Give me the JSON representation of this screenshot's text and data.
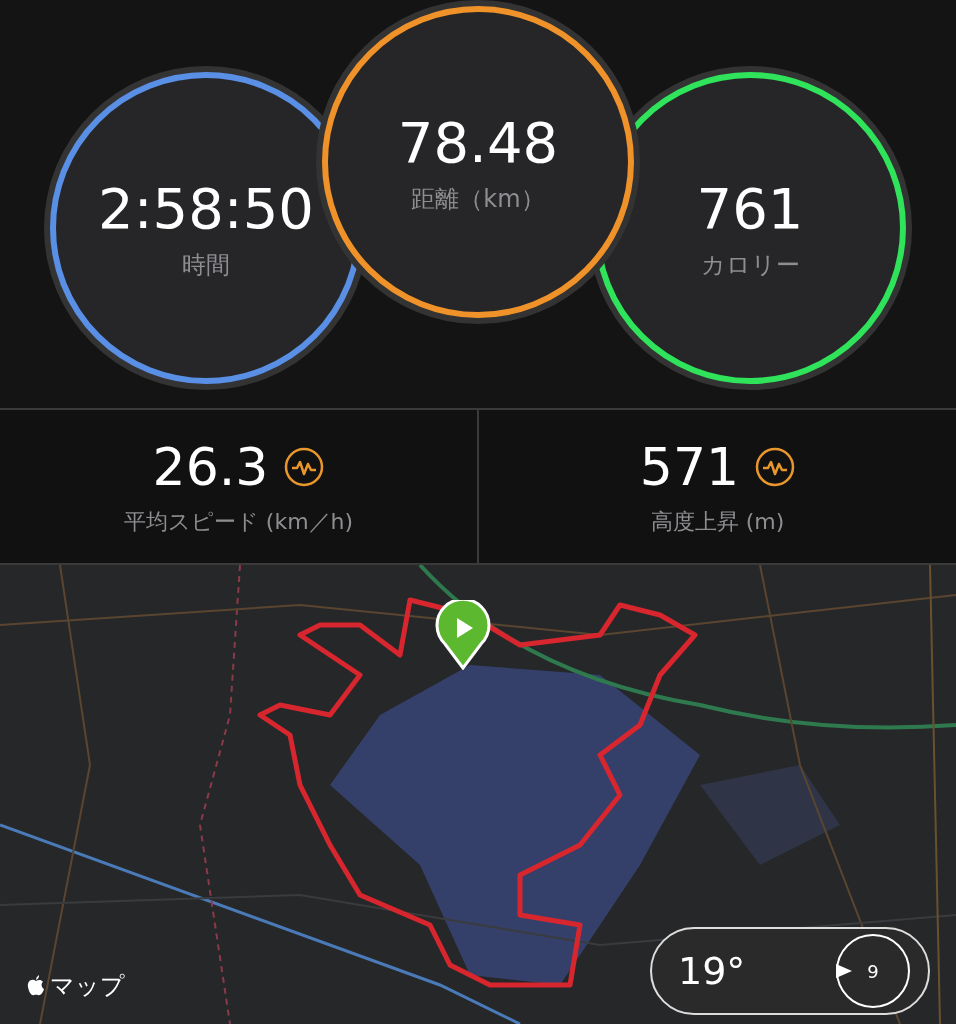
{
  "rings": [
    {
      "value": "2:58:50",
      "label": "時間",
      "color": "#5a8fe6",
      "raised": false
    },
    {
      "value": "78.48",
      "label": "距離（km）",
      "color": "#f0922a",
      "raised": true
    },
    {
      "value": "761",
      "label": "カロリー",
      "color": "#2fe35a",
      "raised": false
    }
  ],
  "stats": [
    {
      "value": "26.3",
      "label": "平均スピード (km／h)"
    },
    {
      "value": "571",
      "label": "高度上昇 (m)"
    }
  ],
  "map": {
    "kind": "picture",
    "attribution": "マップ",
    "weather": {
      "temperature": "19°",
      "wind": "9"
    }
  }
}
